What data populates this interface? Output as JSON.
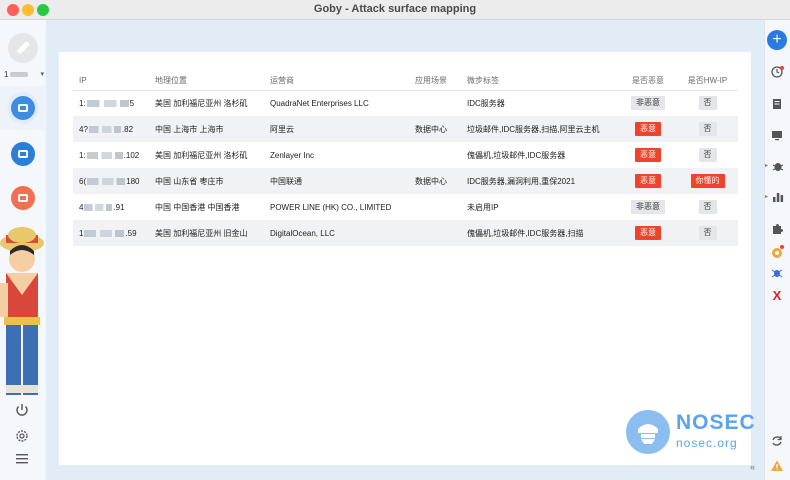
{
  "window": {
    "title": "Goby - Attack surface mapping"
  },
  "sidebar": {
    "user_prefix": "1",
    "nav": [
      "asset-scan",
      "assets-list",
      "vuln",
      "chart",
      "plugin"
    ]
  },
  "table": {
    "headers": [
      "IP",
      "地理位置",
      "运营商",
      "应用场景",
      "微步标签",
      "是否恶意",
      "是否HW-IP"
    ],
    "rows": [
      {
        "ip_head": "1:",
        "ip_tail": "5",
        "location": "美国 加利福尼亚州 洛杉矶",
        "isp": "QuadraNet Enterprises LLC",
        "scene": "",
        "tags": "IDC服务器",
        "malicious": "非恶意",
        "malicious_level": "safe",
        "hw": "否",
        "hw_level": "no"
      },
      {
        "ip_head": "4?",
        "ip_tail": ".82",
        "location": "中国 上海市 上海市",
        "isp": "阿里云",
        "scene": "数据中心",
        "tags": "垃圾邮件,IDC服务器,扫描,阿里云主机",
        "malicious": "恶意",
        "malicious_level": "bad",
        "hw": "否",
        "hw_level": "no"
      },
      {
        "ip_head": "1:",
        "ip_tail": ".102",
        "location": "美国 加利福尼亚州 洛杉矶",
        "isp": "Zenlayer Inc",
        "scene": "",
        "tags": "傀儡机,垃圾邮件,IDC服务器",
        "malicious": "恶意",
        "malicious_level": "bad",
        "hw": "否",
        "hw_level": "no"
      },
      {
        "ip_head": "6(",
        "ip_tail": "180",
        "location": "中国 山东省 枣庄市",
        "isp": "中国联通",
        "scene": "数据中心",
        "tags": "IDC服务器,漏洞利用,重保2021",
        "malicious": "恶意",
        "malicious_level": "bad",
        "hw": "你懂的",
        "hw_level": "hw"
      },
      {
        "ip_head": "4",
        "ip_tail": ".91",
        "location": "中国 中国香港 中国香港",
        "isp": "POWER LINE (HK) CO., LIMITED",
        "scene": "",
        "tags": "未启用IP",
        "malicious": "非恶意",
        "malicious_level": "safe",
        "hw": "否",
        "hw_level": "no"
      },
      {
        "ip_head": "1",
        "ip_tail": ".59",
        "location": "美国 加利福尼亚州 旧金山",
        "isp": "DigitalOcean, LLC",
        "scene": "",
        "tags": "傀儡机,垃圾邮件,IDC服务器,扫描",
        "malicious": "恶意",
        "malicious_level": "bad",
        "hw": "否",
        "hw_level": "no"
      }
    ]
  },
  "watermark": {
    "brand": "NOSEC",
    "url": "nosec.org"
  },
  "right_rail": {
    "add_label": "+",
    "collapse_label": "«",
    "x_label": "X"
  },
  "colors": {
    "accent": "#2a7ae2",
    "danger": "#f0432c",
    "brand": "#5aa3ee"
  }
}
